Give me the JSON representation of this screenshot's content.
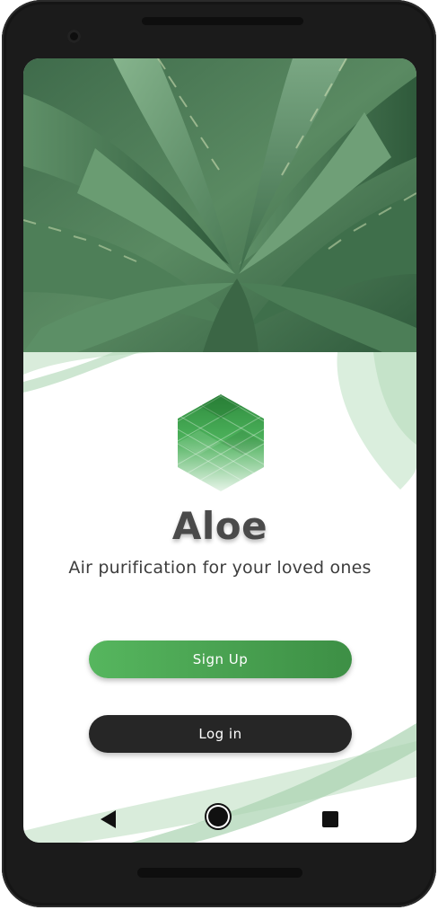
{
  "app": {
    "name": "Aloe",
    "tagline": "Air purification for your loved ones"
  },
  "actions": {
    "signup_label": "Sign Up",
    "login_label": "Log in"
  },
  "hero": {
    "image": "aloe-plant-photo"
  },
  "logo": {
    "icon": "hexagon-logo-icon"
  },
  "navbar": {
    "back_icon": "back-triangle-icon",
    "home_icon": "home-circle-icon",
    "recents_icon": "recents-square-icon"
  },
  "colors": {
    "accent": "#4caf50",
    "accent_dark": "#3d8f45",
    "button_dark": "#262626",
    "title": "#4a4a4a",
    "decor": "#bfe0c4"
  }
}
